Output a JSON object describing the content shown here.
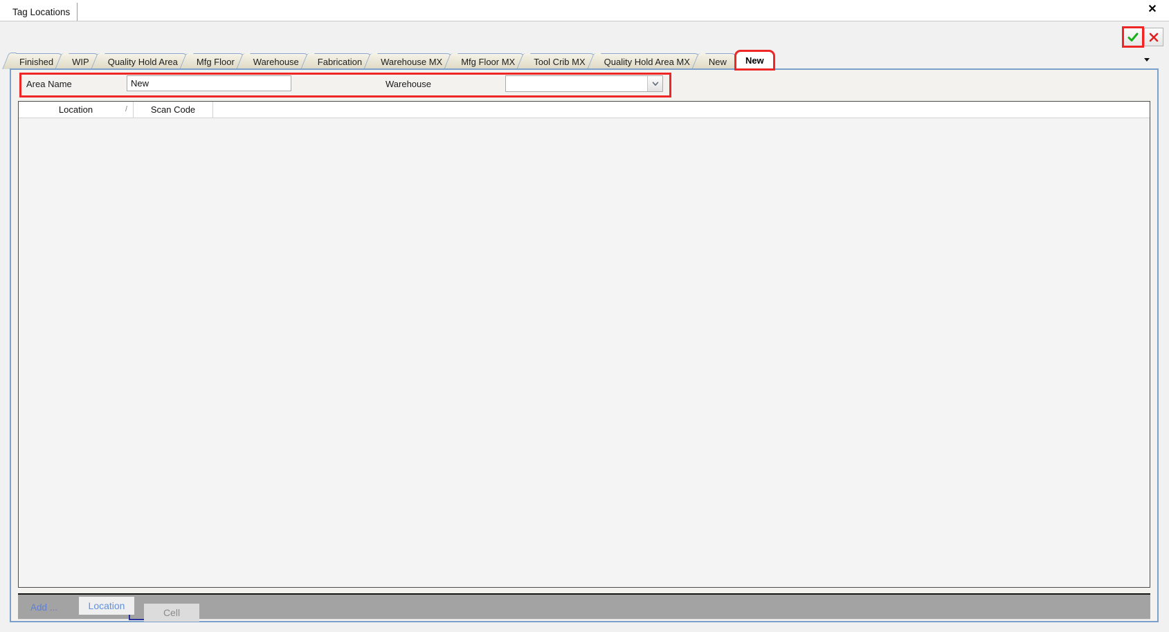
{
  "window": {
    "document_tab": "Tag Locations",
    "close_label": "✕"
  },
  "action_bar": {
    "accept_name": "accept",
    "cancel_name": "cancel"
  },
  "tabs": {
    "items": [
      {
        "label": "Finished",
        "selected": false
      },
      {
        "label": "WIP",
        "selected": false
      },
      {
        "label": "Quality Hold Area",
        "selected": false
      },
      {
        "label": "Mfg Floor",
        "selected": false
      },
      {
        "label": "Warehouse",
        "selected": false
      },
      {
        "label": "Fabrication",
        "selected": false
      },
      {
        "label": "Warehouse MX",
        "selected": false
      },
      {
        "label": "Mfg Floor MX",
        "selected": false
      },
      {
        "label": "Tool Crib MX",
        "selected": false
      },
      {
        "label": "Quality Hold Area MX",
        "selected": false
      },
      {
        "label": "New",
        "selected": false
      },
      {
        "label": "New",
        "selected": true
      }
    ],
    "overflow_glyph": "▼"
  },
  "form": {
    "area_name_label": "Area Name",
    "area_name_value": "New",
    "area_name_placeholder": "",
    "warehouse_label": "Warehouse",
    "warehouse_value": "",
    "warehouse_placeholder": "",
    "warehouse_dropdown_glyph": "⌄"
  },
  "grid": {
    "columns": [
      {
        "label": "Location",
        "sort": "/"
      },
      {
        "label": "Scan Code",
        "sort": ""
      }
    ],
    "rows": []
  },
  "bottom_bar": {
    "add_label": "Add ...",
    "location_button": "Location",
    "cell_button": "Cell"
  },
  "colors": {
    "highlight_red": "#ef2626",
    "tab_border_blue": "#7ba0cc",
    "link_blue": "#5f8fe0",
    "toolbar_gray": "#a3a3a3",
    "accept_green": "#1fb81f",
    "cancel_red": "#e02020"
  }
}
